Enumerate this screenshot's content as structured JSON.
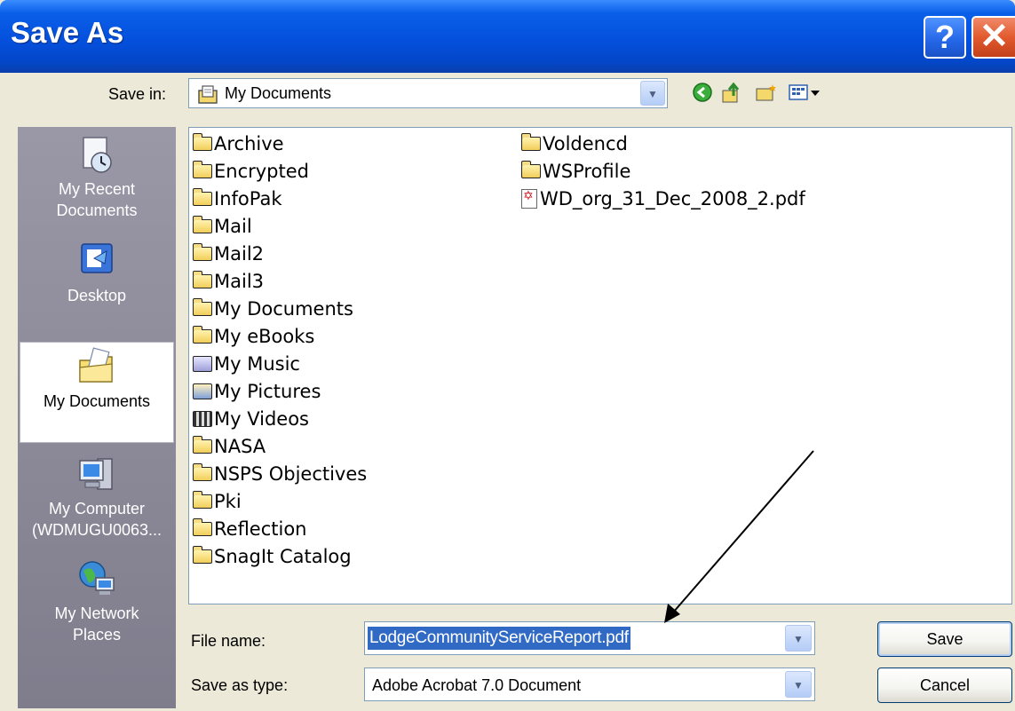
{
  "window": {
    "title": "Save As",
    "help_label": "?",
    "close_label": "✕"
  },
  "save_in": {
    "label": "Save in:",
    "value": "My Documents"
  },
  "places": [
    {
      "label": "My Recent\nDocuments",
      "icon": "recent-documents-icon"
    },
    {
      "label": "Desktop",
      "icon": "desktop-icon"
    },
    {
      "label": "My Documents",
      "icon": "my-documents-icon",
      "selected": true
    },
    {
      "label": "My Computer\n(WDMUGU0063...",
      "icon": "my-computer-icon"
    },
    {
      "label": "My Network\nPlaces",
      "icon": "network-places-icon"
    }
  ],
  "files": {
    "col1": [
      {
        "name": "Archive",
        "icon": "folder"
      },
      {
        "name": "Encrypted",
        "icon": "folder"
      },
      {
        "name": "InfoPak",
        "icon": "folder"
      },
      {
        "name": "Mail",
        "icon": "folder"
      },
      {
        "name": "Mail2",
        "icon": "folder"
      },
      {
        "name": "Mail3",
        "icon": "folder"
      },
      {
        "name": "My Documents",
        "icon": "folder"
      },
      {
        "name": "My eBooks",
        "icon": "folder"
      },
      {
        "name": "My Music",
        "icon": "music"
      },
      {
        "name": "My Pictures",
        "icon": "pictures"
      },
      {
        "name": "My Videos",
        "icon": "videos"
      },
      {
        "name": "NASA",
        "icon": "folder"
      },
      {
        "name": "NSPS Objectives",
        "icon": "folder"
      },
      {
        "name": "Pki",
        "icon": "folder"
      },
      {
        "name": "Reflection",
        "icon": "folder"
      },
      {
        "name": "SnagIt Catalog",
        "icon": "folder"
      }
    ],
    "col2": [
      {
        "name": "Voldencd",
        "icon": "folder"
      },
      {
        "name": "WSProfile",
        "icon": "folder"
      },
      {
        "name": "WD_org_31_Dec_2008_2.pdf",
        "icon": "pdf"
      }
    ]
  },
  "file_name": {
    "label": "File name:",
    "value": "LodgeCommunityServiceReport.pdf"
  },
  "save_as_type": {
    "label": "Save as type:",
    "value": "Adobe Acrobat 7.0 Document"
  },
  "buttons": {
    "save": "Save",
    "cancel": "Cancel"
  }
}
